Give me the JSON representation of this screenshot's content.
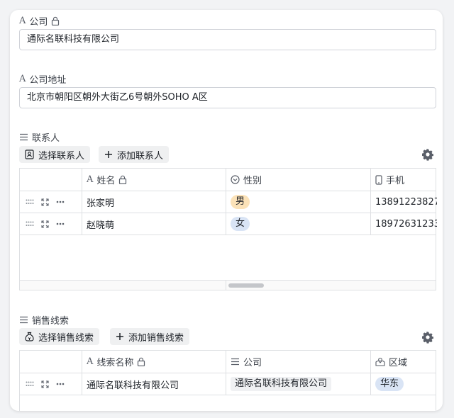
{
  "company": {
    "label": "公司",
    "value": "通际名联科技有限公司"
  },
  "address": {
    "label": "公司地址",
    "value": "北京市朝阳区朝外大街乙6号朝外SOHO A区"
  },
  "contacts": {
    "label": "联系人",
    "select_button": "选择联系人",
    "add_button": "添加联系人",
    "columns": [
      "姓名",
      "性别",
      "手机"
    ],
    "rows": [
      {
        "name": "张家明",
        "gender": "男",
        "phone": "13891223827"
      },
      {
        "name": "赵晓萌",
        "gender": "女",
        "phone": "18972631233"
      }
    ]
  },
  "leads": {
    "label": "销售线索",
    "select_button": "选择销售线索",
    "add_button": "添加销售线索",
    "columns": [
      "线索名称",
      "公司",
      "区域"
    ],
    "rows": [
      {
        "name": "通际名联科技有限公司",
        "company": "通际名联科技有限公司",
        "region": "华东"
      }
    ]
  },
  "colors": {
    "male_pill": "#fbe2b8",
    "female_pill": "#d9e4f5",
    "border": "#dee0e3"
  },
  "icons": [
    "text-field-icon",
    "lock-icon",
    "list-icon",
    "contact-card-icon",
    "plus-icon",
    "gear-icon",
    "single-select-icon",
    "phone-icon",
    "money-bag-icon",
    "location-icon",
    "drag-handle-icon",
    "expand-icon",
    "more-icon"
  ]
}
